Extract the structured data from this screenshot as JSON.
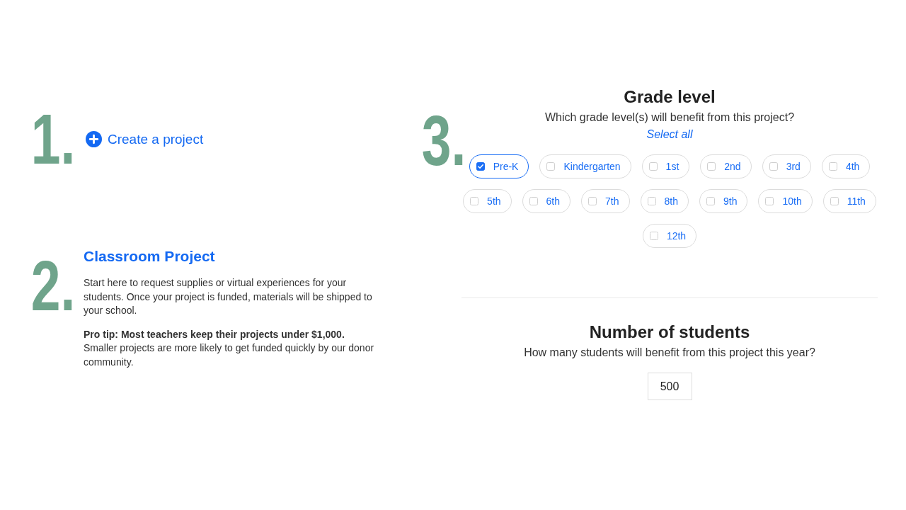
{
  "steps": [
    {
      "kind": "action",
      "number": "1.",
      "link": {
        "label": "Create a project"
      }
    },
    {
      "kind": "info",
      "number": "2.",
      "title": "Classroom Project",
      "paragraphs": [
        "Start here to request supplies or virtual experiences for your students. Once your project is funded, materials will be shipped to your school.",
        "**Pro tip: Most teachers keep their projects under $1,000.** Smaller projects are more likely to get funded quickly by our donor community."
      ]
    },
    {
      "kind": "form",
      "number": "3.",
      "grade_level": {
        "title": "Grade level",
        "prompt": "Which grade level(s) will benefit from this project?",
        "select_all": "Select all",
        "grades": [
          {
            "label": "Pre-K",
            "checked": true
          },
          {
            "label": "Kindergarten",
            "checked": false
          },
          {
            "label": "1st",
            "checked": false
          },
          {
            "label": "2nd",
            "checked": false
          },
          {
            "label": "3rd",
            "checked": false
          },
          {
            "label": "4th",
            "checked": false
          },
          {
            "label": "5th",
            "checked": false
          },
          {
            "label": "6th",
            "checked": false
          },
          {
            "label": "7th",
            "checked": false
          },
          {
            "label": "8th",
            "checked": false
          },
          {
            "label": "9th",
            "checked": false
          },
          {
            "label": "10th",
            "checked": false
          },
          {
            "label": "11th",
            "checked": false
          },
          {
            "label": "12th",
            "checked": false
          }
        ]
      },
      "students": {
        "title": "Number of students",
        "prompt": "How many students will benefit from this project this year?",
        "value": "500"
      }
    }
  ]
}
